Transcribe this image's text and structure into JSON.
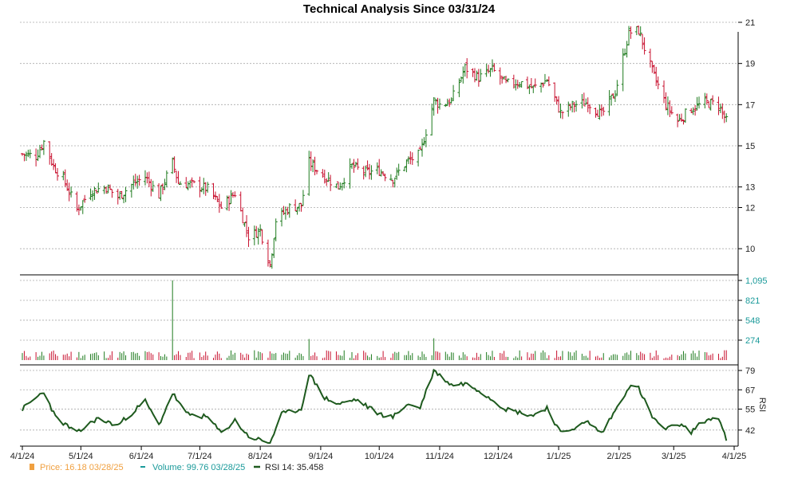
{
  "chart_data": {
    "type": "line",
    "title": "Technical Analysis Since 03/31/24",
    "colors": {
      "up": "#1e7b1e",
      "down": "#c8102e",
      "volume_axis": "#1a9a9a",
      "price_legend": "#f0a040",
      "rsi": "#1e5a1e",
      "grid": "#aaaaaa"
    },
    "price_panel": {
      "ylim": [
        9,
        21
      ],
      "y_ticks": [
        "10",
        "12",
        "13",
        "15",
        "17",
        "19",
        "21"
      ],
      "y_tick_values": [
        10,
        12,
        13,
        15,
        17,
        19,
        21
      ],
      "grid": true,
      "series_anchors": [
        [
          "2024-04-01",
          14.6
        ],
        [
          "2024-04-08",
          14.5
        ],
        [
          "2024-04-12",
          15.2
        ],
        [
          "2024-04-17",
          14.0
        ],
        [
          "2024-04-22",
          13.4
        ],
        [
          "2024-04-29",
          11.9
        ],
        [
          "2024-05-06",
          12.8
        ],
        [
          "2024-05-14",
          13.0
        ],
        [
          "2024-05-20",
          12.5
        ],
        [
          "2024-05-27",
          13.1
        ],
        [
          "2024-06-03",
          13.5
        ],
        [
          "2024-06-10",
          12.6
        ],
        [
          "2024-06-17",
          14.2
        ],
        [
          "2024-06-20",
          13.2
        ],
        [
          "2024-06-28",
          13.1
        ],
        [
          "2024-07-05",
          12.9
        ],
        [
          "2024-07-12",
          12.0
        ],
        [
          "2024-07-19",
          12.7
        ],
        [
          "2024-07-26",
          10.6
        ],
        [
          "2024-08-01",
          10.9
        ],
        [
          "2024-08-06",
          9.2
        ],
        [
          "2024-08-09",
          11.4
        ],
        [
          "2024-08-16",
          12.0
        ],
        [
          "2024-08-22",
          12.1
        ],
        [
          "2024-08-26",
          14.2
        ],
        [
          "2024-09-03",
          13.5
        ],
        [
          "2024-09-10",
          13.0
        ],
        [
          "2024-09-17",
          14.0
        ],
        [
          "2024-09-24",
          13.7
        ],
        [
          "2024-10-01",
          13.8
        ],
        [
          "2024-10-08",
          13.4
        ],
        [
          "2024-10-15",
          14.2
        ],
        [
          "2024-10-22",
          14.6
        ],
        [
          "2024-10-29",
          17.2
        ],
        [
          "2024-11-01",
          17.0
        ],
        [
          "2024-11-07",
          17.2
        ],
        [
          "2024-11-14",
          18.8
        ],
        [
          "2024-11-21",
          18.3
        ],
        [
          "2024-11-28",
          18.7
        ],
        [
          "2024-12-05",
          18.0
        ],
        [
          "2024-12-12",
          18.1
        ],
        [
          "2024-12-19",
          17.8
        ],
        [
          "2024-12-26",
          18.2
        ],
        [
          "2025-01-02",
          16.6
        ],
        [
          "2025-01-09",
          17.0
        ],
        [
          "2025-01-16",
          17.1
        ],
        [
          "2025-01-23",
          16.5
        ],
        [
          "2025-01-30",
          17.6
        ],
        [
          "2025-02-06",
          20.5
        ],
        [
          "2025-02-11",
          20.6
        ],
        [
          "2025-02-18",
          18.6
        ],
        [
          "2025-02-25",
          17.0
        ],
        [
          "2025-03-03",
          16.2
        ],
        [
          "2025-03-10",
          16.8
        ],
        [
          "2025-03-17",
          17.1
        ],
        [
          "2025-03-24",
          17.0
        ],
        [
          "2025-03-28",
          16.18
        ]
      ]
    },
    "volume_panel": {
      "ylim": [
        0,
        1095
      ],
      "y_ticks": [
        "274",
        "548",
        "821",
        "1,095"
      ],
      "y_tick_values": [
        274,
        548,
        821,
        1095
      ],
      "spikes": [
        [
          "2024-06-17",
          1095
        ],
        [
          "2024-08-26",
          290
        ],
        [
          "2024-10-29",
          300
        ]
      ],
      "typical_volume": 80
    },
    "rsi_panel": {
      "ylim": [
        34,
        80
      ],
      "y_ticks": [
        "42",
        "55",
        "67",
        "79"
      ],
      "y_tick_values": [
        42,
        55,
        67,
        79
      ],
      "axis_label": "RSI",
      "series_anchors": [
        [
          "2024-04-01",
          55
        ],
        [
          "2024-04-12",
          66
        ],
        [
          "2024-04-18",
          50
        ],
        [
          "2024-04-29",
          40
        ],
        [
          "2024-05-09",
          49
        ],
        [
          "2024-05-20",
          45
        ],
        [
          "2024-06-03",
          60
        ],
        [
          "2024-06-10",
          45
        ],
        [
          "2024-06-17",
          65
        ],
        [
          "2024-06-24",
          52
        ],
        [
          "2024-07-05",
          50
        ],
        [
          "2024-07-12",
          40
        ],
        [
          "2024-07-19",
          48
        ],
        [
          "2024-07-26",
          38
        ],
        [
          "2024-08-06",
          34
        ],
        [
          "2024-08-12",
          52
        ],
        [
          "2024-08-22",
          55
        ],
        [
          "2024-08-26",
          77
        ],
        [
          "2024-09-03",
          62
        ],
        [
          "2024-09-10",
          58
        ],
        [
          "2024-09-19",
          61
        ],
        [
          "2024-10-01",
          52
        ],
        [
          "2024-10-08",
          50
        ],
        [
          "2024-10-15",
          58
        ],
        [
          "2024-10-22",
          56
        ],
        [
          "2024-10-29",
          79
        ],
        [
          "2024-11-07",
          70
        ],
        [
          "2024-11-14",
          71
        ],
        [
          "2024-11-21",
          67
        ],
        [
          "2024-12-05",
          55
        ],
        [
          "2024-12-19",
          51
        ],
        [
          "2024-12-26",
          56
        ],
        [
          "2025-01-02",
          40
        ],
        [
          "2025-01-16",
          47
        ],
        [
          "2025-01-23",
          40
        ],
        [
          "2025-01-30",
          54
        ],
        [
          "2025-02-06",
          69
        ],
        [
          "2025-02-11",
          68
        ],
        [
          "2025-02-18",
          50
        ],
        [
          "2025-02-25",
          42
        ],
        [
          "2025-03-03",
          46
        ],
        [
          "2025-03-10",
          41
        ],
        [
          "2025-03-17",
          48
        ],
        [
          "2025-03-24",
          50
        ],
        [
          "2025-03-28",
          35.458
        ]
      ]
    },
    "x_axis": {
      "ticks": [
        "4/1/24",
        "5/1/24",
        "6/1/24",
        "7/1/24",
        "8/1/24",
        "9/1/24",
        "10/1/24",
        "11/1/24",
        "12/1/24",
        "1/1/25",
        "2/1/25",
        "3/1/25",
        "4/1/25"
      ],
      "tick_dates": [
        "2024-04-01",
        "2024-05-01",
        "2024-06-01",
        "2024-07-01",
        "2024-08-01",
        "2024-09-01",
        "2024-10-01",
        "2024-11-01",
        "2024-12-01",
        "2025-01-01",
        "2025-02-01",
        "2025-03-01",
        "2025-04-01"
      ]
    },
    "legend": {
      "price": "Price: 16.18  03/28/25",
      "volume": "Volume: 99.76  03/28/25",
      "rsi": "RSI 14: 35.458"
    }
  }
}
